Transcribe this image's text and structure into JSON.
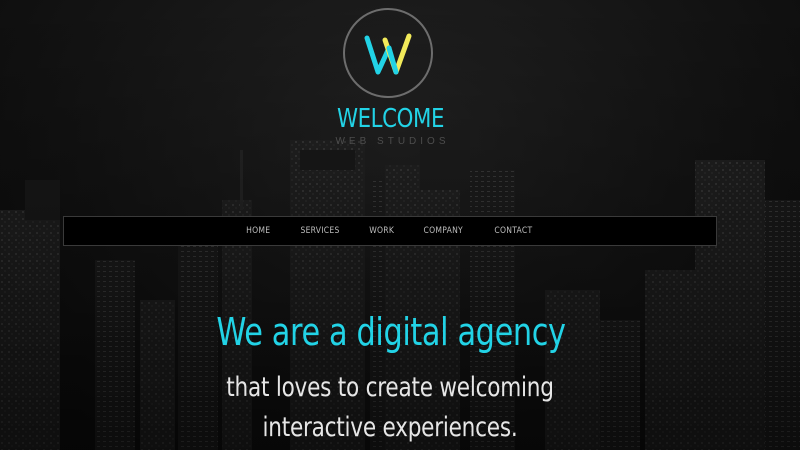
{
  "brand": {
    "logo_icon": "w-monogram-icon",
    "name": "WELCOME",
    "tagline": "WEB STUDIOS"
  },
  "nav": {
    "items": [
      {
        "label": "HOME"
      },
      {
        "label": "SERVICES"
      },
      {
        "label": "WORK"
      },
      {
        "label": "COMPANY"
      },
      {
        "label": "CONTACT"
      }
    ]
  },
  "hero": {
    "title": "We are a digital agency",
    "subtitle_line1": "that loves to create welcoming",
    "subtitle_line2": "interactive experiences."
  },
  "colors": {
    "accent_cyan": "#22d3e6",
    "accent_yellow": "#f2ea5a",
    "background": "#111111"
  }
}
